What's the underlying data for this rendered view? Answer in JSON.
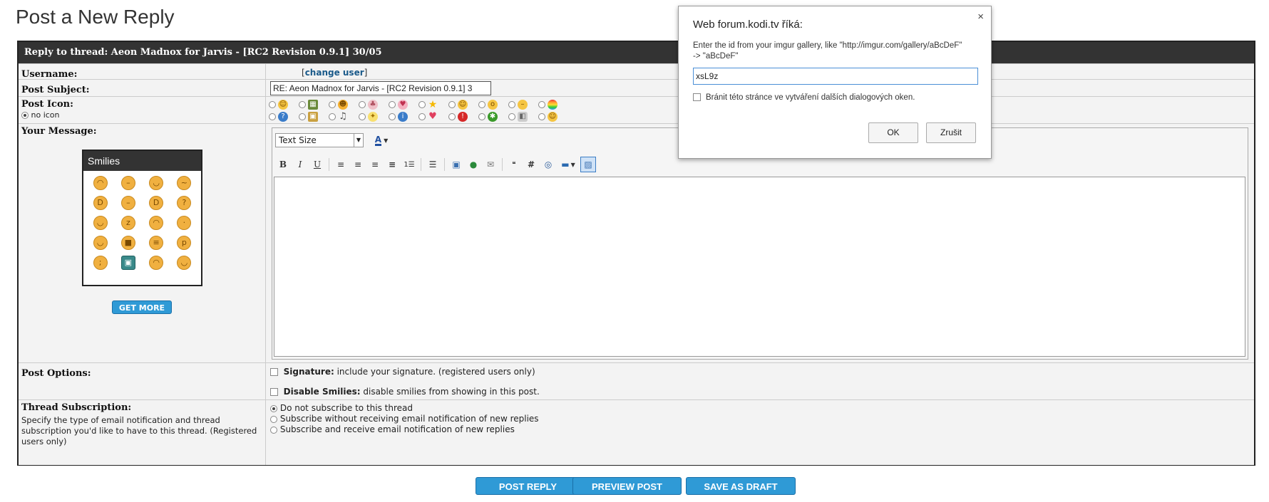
{
  "page_title": "Post a New Reply",
  "thread_header": "Reply to thread: Aeon Madnox for Jarvis - [RC2 Revision 0.9.1] 30/05",
  "username": {
    "label": "Username:",
    "bracket_open": "[",
    "link": "change user",
    "bracket_close": "]"
  },
  "subject": {
    "label": "Post Subject:",
    "value": "RE: Aeon Madnox for Jarvis - [RC2 Revision 0.9.1] 3"
  },
  "post_icon": {
    "label": "Post Icon:",
    "no_icon": "no icon"
  },
  "message": {
    "label": "Your Message:",
    "text_size": "Text Size",
    "smilies_title": "Smilies",
    "get_more": "GET MORE",
    "body": ""
  },
  "post_options": {
    "label": "Post Options:",
    "signature_bold": "Signature:",
    "signature_text": "include your signature. (registered users only)",
    "smilies_bold": "Disable Smilies:",
    "smilies_text": "disable smilies from showing in this post."
  },
  "subscription": {
    "label": "Thread Subscription:",
    "description": "Specify the type of email notification and thread subscription you'd like to have to this thread. (Registered users only)",
    "options": [
      "Do not subscribe to this thread",
      "Subscribe without receiving email notification of new replies",
      "Subscribe and receive email notification of new replies"
    ],
    "selected_index": 0
  },
  "buttons": {
    "post_reply": "POST REPLY",
    "preview_post": "PREVIEW POST",
    "save_draft": "SAVE AS DRAFT"
  },
  "dialog": {
    "title": "Web forum.kodi.tv říká:",
    "message": "Enter the id from your imgur gallery, like \"http://imgur.com/gallery/aBcDeF\" -> \"aBcDeF\"",
    "input_value": "xsL9z",
    "checkbox_label": "Bránit této stránce ve vytváření dalších dialogových oken.",
    "ok": "OK",
    "cancel": "Zrušit",
    "close": "×"
  },
  "colors": {
    "header_bg": "#333333",
    "button_blue": "#2f9ad6",
    "link": "#1a5a8a"
  }
}
